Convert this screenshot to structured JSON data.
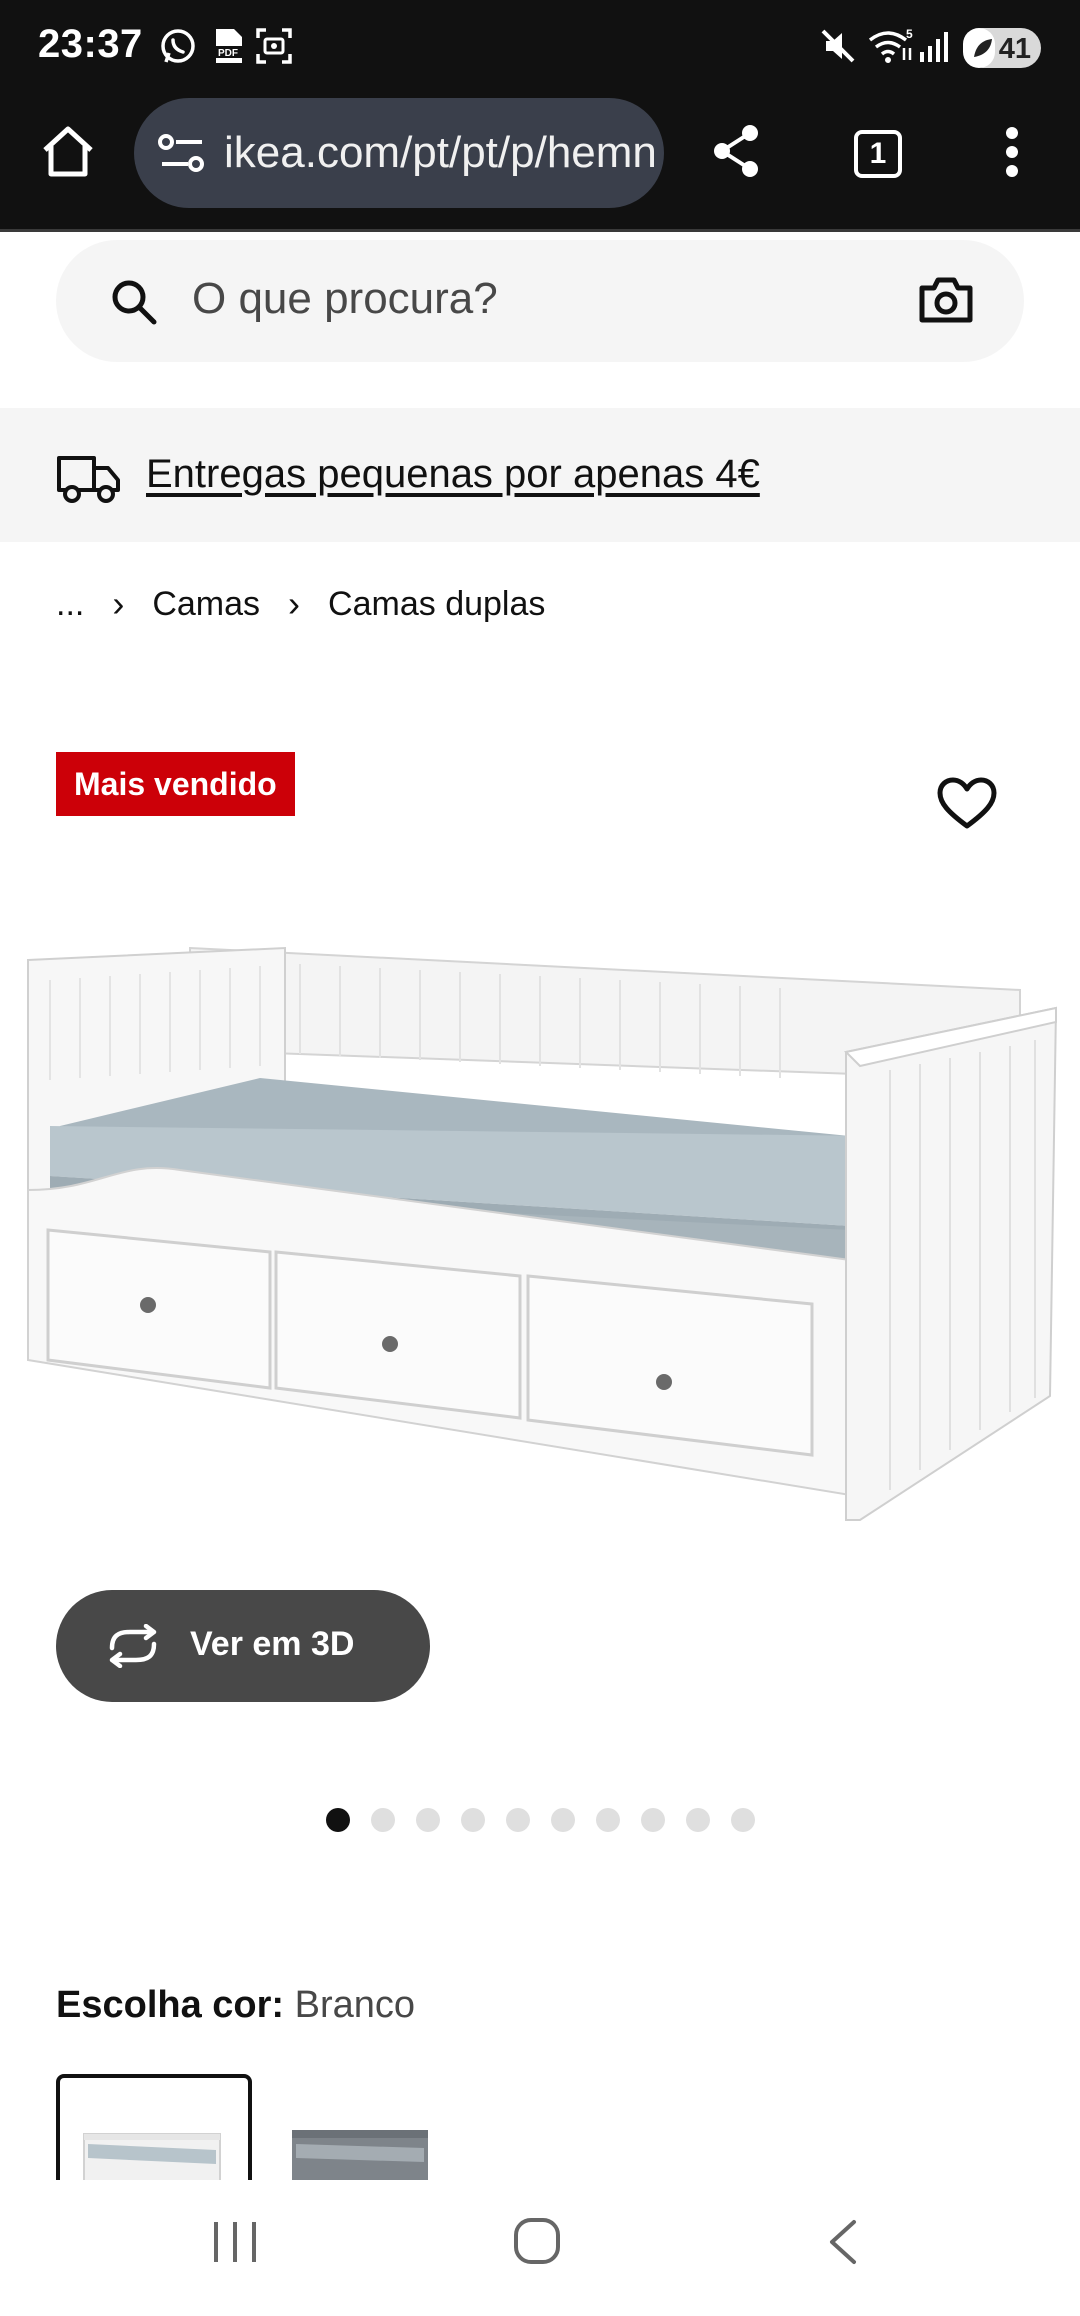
{
  "status_bar": {
    "time": "23:37",
    "battery_level": "41",
    "icons": [
      "whatsapp-icon",
      "pdf-icon",
      "screenshot-icon",
      "mute-icon",
      "wifi-icon",
      "signal-icon"
    ]
  },
  "browser": {
    "url": "ikea.com/pt/pt/p/hemnes",
    "tab_count": "1"
  },
  "search": {
    "placeholder": "O que procura?"
  },
  "delivery_banner": {
    "text": "Entregas pequenas por apenas 4€"
  },
  "breadcrumb": {
    "items": [
      "...",
      "Camas",
      "Camas duplas"
    ]
  },
  "product": {
    "badge": "Mais vendido",
    "view3d_label": "Ver em 3D",
    "image_count": 10,
    "active_image": 1
  },
  "color_choice": {
    "label": "Escolha cor:",
    "value": "Branco"
  },
  "colors": {
    "accent_red": "#cc0008",
    "dark": "#111111",
    "button_gray": "#484848",
    "banner_bg": "#f5f5f5"
  }
}
